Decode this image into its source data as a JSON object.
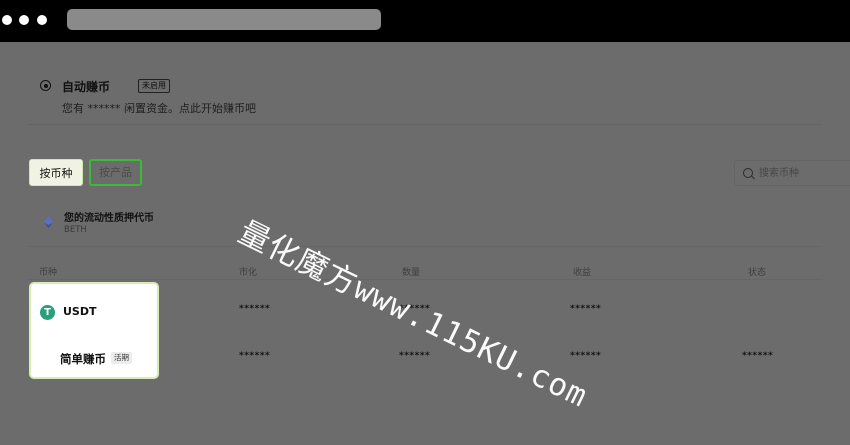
{
  "window": {
    "controls": [
      "close",
      "minimize",
      "maximize"
    ]
  },
  "auto_earn": {
    "icon": "target-icon",
    "title": "自动赚币",
    "badge": "未启用",
    "description": "您有 ****** 闲置资金。点此开始赚币吧"
  },
  "tabs": [
    {
      "label": "按币种",
      "active": true
    },
    {
      "label": "按产品",
      "active": false
    }
  ],
  "search": {
    "placeholder": "搜索币种",
    "icon": "search-icon"
  },
  "beth": {
    "icon": "ethereum-icon",
    "title": "您的流动性质押代币",
    "symbol": "BETH"
  },
  "table": {
    "headers": [
      "币种",
      "市化",
      "数量",
      "收益",
      "状态"
    ],
    "rows": [
      {
        "coin": "USDT",
        "values": [
          "******",
          "******",
          "******",
          ""
        ]
      },
      {
        "coin": "简单赚币",
        "values": [
          "******",
          "******",
          "******",
          "******"
        ]
      }
    ]
  },
  "popup": {
    "coin": "USDT",
    "coin_icon": "tether-icon",
    "coin_icon_glyph": "T",
    "product": "简单赚币",
    "product_tag": "活期"
  },
  "watermark": "量化魔方www.115KU.com",
  "colors": {
    "accent_green": "#3dbb37",
    "tether": "#26a17b"
  }
}
